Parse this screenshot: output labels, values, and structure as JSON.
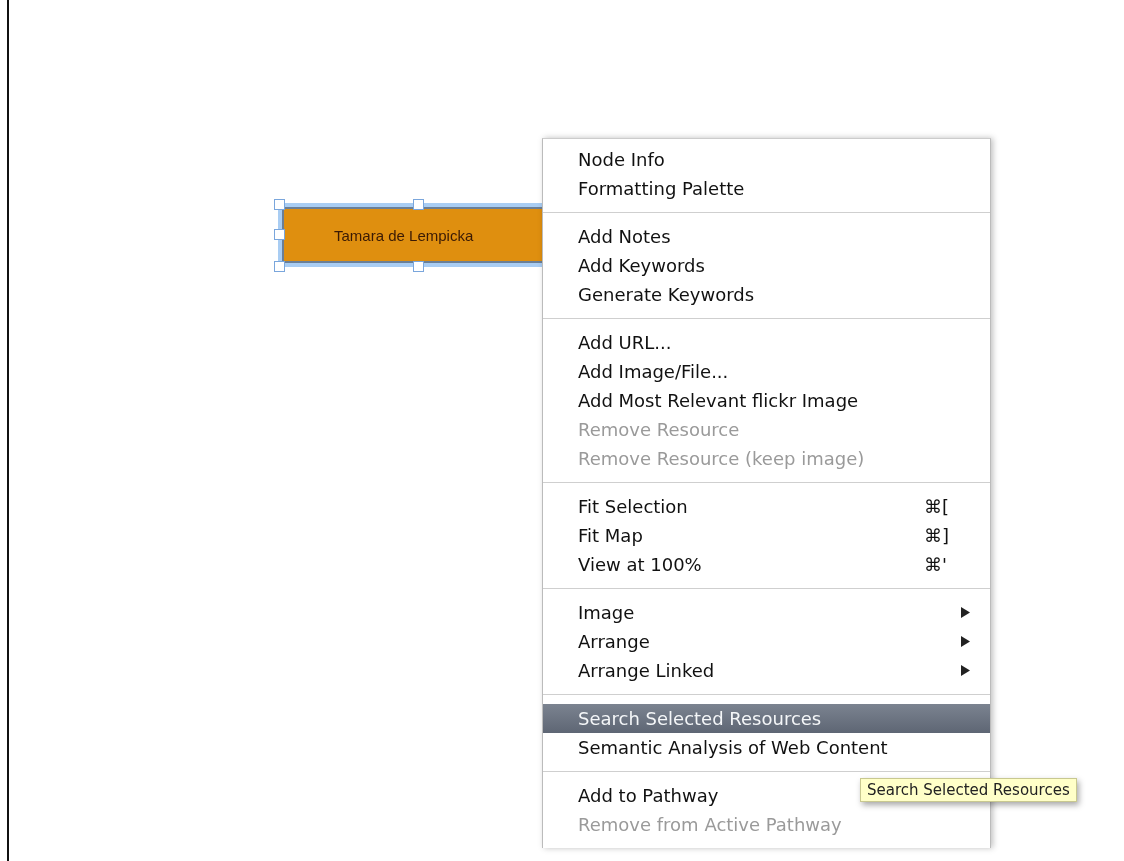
{
  "node": {
    "label": "Tamara de Lempicka",
    "selected": true
  },
  "context_menu": {
    "groups": [
      {
        "items": [
          {
            "label": "Node Info",
            "disabled": false,
            "selected": false,
            "submenu": false
          },
          {
            "label": "Formatting Palette",
            "disabled": false,
            "selected": false,
            "submenu": false
          }
        ]
      },
      {
        "items": [
          {
            "label": "Add Notes",
            "disabled": false,
            "selected": false,
            "submenu": false
          },
          {
            "label": "Add Keywords",
            "disabled": false,
            "selected": false,
            "submenu": false
          },
          {
            "label": "Generate Keywords",
            "disabled": false,
            "selected": false,
            "submenu": false
          }
        ]
      },
      {
        "items": [
          {
            "label": "Add URL...",
            "disabled": false,
            "selected": false,
            "submenu": false
          },
          {
            "label": "Add Image/File...",
            "disabled": false,
            "selected": false,
            "submenu": false
          },
          {
            "label": "Add Most Relevant flickr Image",
            "disabled": false,
            "selected": false,
            "submenu": false
          },
          {
            "label": "Remove Resource",
            "disabled": true,
            "selected": false,
            "submenu": false
          },
          {
            "label": "Remove Resource (keep image)",
            "disabled": true,
            "selected": false,
            "submenu": false
          }
        ]
      },
      {
        "items": [
          {
            "label": "Fit Selection",
            "shortcut": "⌘[",
            "disabled": false,
            "selected": false,
            "submenu": false
          },
          {
            "label": "Fit Map",
            "shortcut": "⌘]",
            "disabled": false,
            "selected": false,
            "submenu": false
          },
          {
            "label": "View at 100%",
            "shortcut": "⌘'",
            "disabled": false,
            "selected": false,
            "submenu": false
          }
        ]
      },
      {
        "items": [
          {
            "label": "Image",
            "disabled": false,
            "selected": false,
            "submenu": true
          },
          {
            "label": "Arrange",
            "disabled": false,
            "selected": false,
            "submenu": true
          },
          {
            "label": "Arrange Linked",
            "disabled": false,
            "selected": false,
            "submenu": true
          }
        ]
      },
      {
        "items": [
          {
            "label": "Search Selected Resources",
            "disabled": false,
            "selected": true,
            "submenu": false
          },
          {
            "label": "Semantic Analysis of Web Content",
            "disabled": false,
            "selected": false,
            "submenu": false
          }
        ]
      },
      {
        "items": [
          {
            "label": "Add to Pathway",
            "disabled": false,
            "selected": false,
            "submenu": false
          },
          {
            "label": "Remove from Active Pathway",
            "disabled": true,
            "selected": false,
            "submenu": false
          }
        ]
      }
    ]
  },
  "tooltip": {
    "text": "Search Selected Resources"
  }
}
